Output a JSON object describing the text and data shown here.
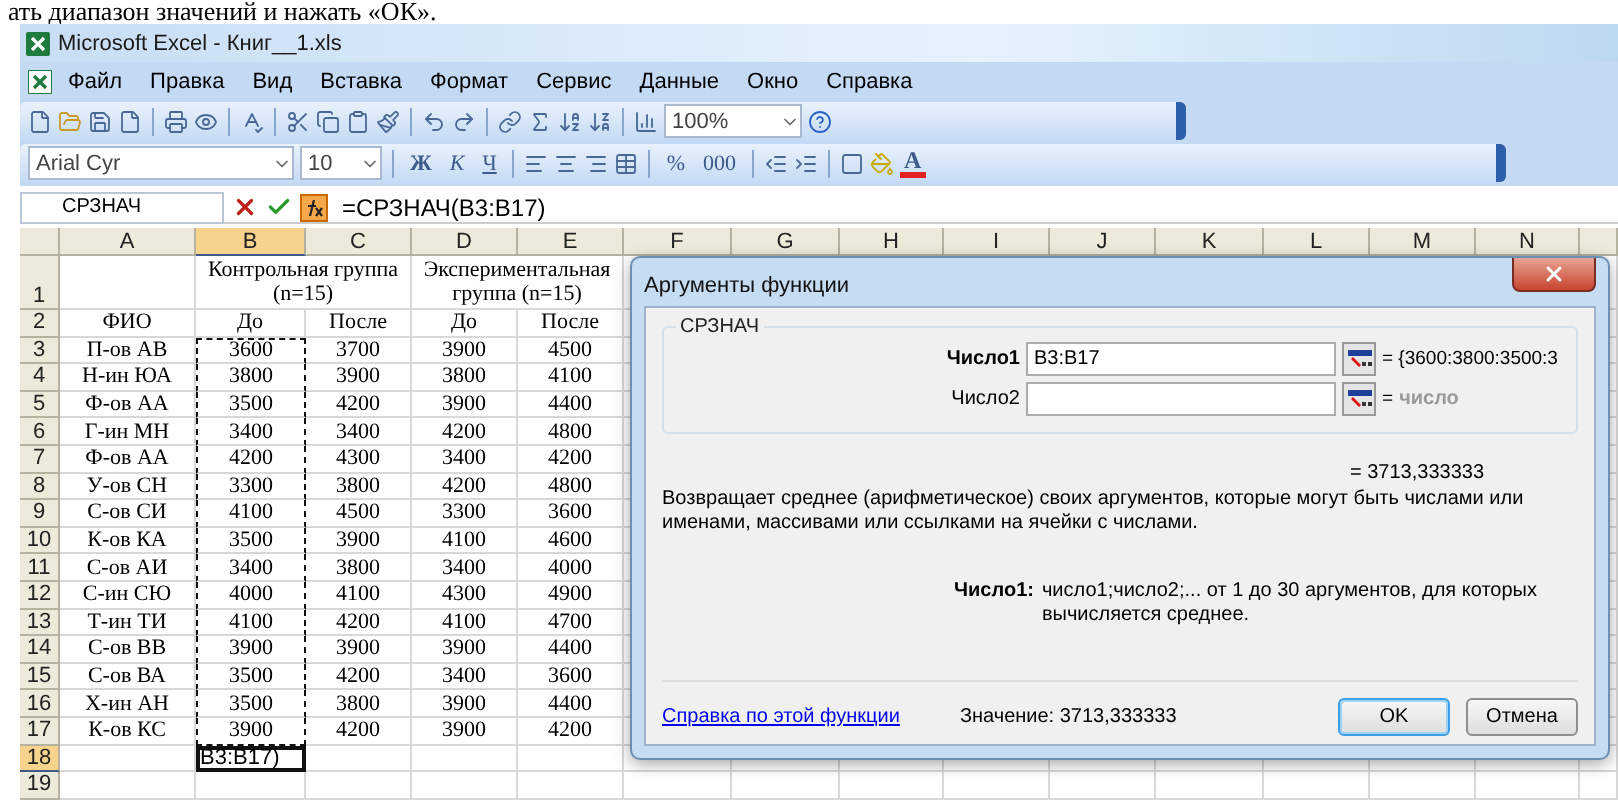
{
  "doc_text": "ать диапазон значений и нажать «ОК».",
  "window": {
    "title": "Microsoft Excel - Книг__1.xls"
  },
  "menu": [
    {
      "label": "Файл"
    },
    {
      "label": "Правка"
    },
    {
      "label": "Вид"
    },
    {
      "label": "Вставка"
    },
    {
      "label": "Формат"
    },
    {
      "label": "Сервис"
    },
    {
      "label": "Данные"
    },
    {
      "label": "Окно"
    },
    {
      "label": "Справка"
    }
  ],
  "toolbar": {
    "zoom": "100%"
  },
  "format_toolbar": {
    "font": "Arial Cyr",
    "size": "10",
    "style_buttons": [
      "Ж",
      "К",
      "Ч"
    ],
    "number_buttons": [
      "%",
      "000"
    ],
    "font_color_glyph": "A"
  },
  "formula_bar": {
    "name_box": "СРЗНАЧ",
    "formula": "=СРЗНАЧ(B3:B17)"
  },
  "sheet": {
    "columns": [
      {
        "label": "A",
        "selected": false
      },
      {
        "label": "B",
        "selected": true
      },
      {
        "label": "C",
        "selected": false
      },
      {
        "label": "D",
        "selected": false
      },
      {
        "label": "E",
        "selected": false
      },
      {
        "label": "F",
        "selected": false
      },
      {
        "label": "G",
        "selected": false
      },
      {
        "label": "H",
        "selected": false
      },
      {
        "label": "I",
        "selected": false
      },
      {
        "label": "J",
        "selected": false
      },
      {
        "label": "K",
        "selected": false
      },
      {
        "label": "L",
        "selected": false
      },
      {
        "label": "M",
        "selected": false
      },
      {
        "label": "N",
        "selected": false
      }
    ],
    "rows": [
      {
        "label": "1",
        "selected": false,
        "in_range": false,
        "groups": [
          "Контрольная группа (n=15)",
          "Экспериментальная группа (n=15)"
        ]
      },
      {
        "label": "2",
        "selected": false,
        "in_range": false,
        "cells": [
          "ФИО",
          "До",
          "После",
          "До",
          "После"
        ]
      },
      {
        "label": "3",
        "selected": false,
        "in_range": true,
        "cells": [
          "П-ов АВ",
          "3600",
          "3700",
          "3900",
          "4500"
        ]
      },
      {
        "label": "4",
        "selected": false,
        "in_range": true,
        "cells": [
          "Н-ин ЮА",
          "3800",
          "3900",
          "3800",
          "4100"
        ]
      },
      {
        "label": "5",
        "selected": false,
        "in_range": true,
        "cells": [
          "Ф-ов АА",
          "3500",
          "4200",
          "3900",
          "4400"
        ]
      },
      {
        "label": "6",
        "selected": false,
        "in_range": true,
        "cells": [
          "Г-ин МН",
          "3400",
          "3400",
          "4200",
          "4800"
        ]
      },
      {
        "label": "7",
        "selected": false,
        "in_range": true,
        "cells": [
          "Ф-ов АА",
          "4200",
          "4300",
          "3400",
          "4200"
        ]
      },
      {
        "label": "8",
        "selected": false,
        "in_range": true,
        "cells": [
          "У-ов СН",
          "3300",
          "3800",
          "4200",
          "4800"
        ]
      },
      {
        "label": "9",
        "selected": false,
        "in_range": true,
        "cells": [
          "С-ов СИ",
          "4100",
          "4500",
          "3300",
          "3600"
        ]
      },
      {
        "label": "10",
        "selected": false,
        "in_range": true,
        "cells": [
          "К-ов КА",
          "3500",
          "3900",
          "4100",
          "4600"
        ]
      },
      {
        "label": "11",
        "selected": false,
        "in_range": true,
        "cells": [
          "С-ов АИ",
          "3400",
          "3800",
          "3400",
          "4000"
        ]
      },
      {
        "label": "12",
        "selected": false,
        "in_range": true,
        "cells": [
          "С-ин СЮ",
          "4000",
          "4100",
          "4300",
          "4900"
        ]
      },
      {
        "label": "13",
        "selected": false,
        "in_range": true,
        "cells": [
          "Т-ин ТИ",
          "4100",
          "4200",
          "4100",
          "4700"
        ]
      },
      {
        "label": "14",
        "selected": false,
        "in_range": true,
        "cells": [
          "С-ов ВВ",
          "3900",
          "3900",
          "3900",
          "4400"
        ]
      },
      {
        "label": "15",
        "selected": false,
        "in_range": true,
        "cells": [
          "С-ов ВА",
          "3500",
          "4200",
          "3400",
          "3600"
        ]
      },
      {
        "label": "16",
        "selected": false,
        "in_range": true,
        "cells": [
          "Х-ин АН",
          "3500",
          "3800",
          "3900",
          "4400"
        ]
      },
      {
        "label": "17",
        "selected": false,
        "in_range": true,
        "cells": [
          "К-ов КС",
          "3900",
          "4200",
          "3900",
          "4200"
        ]
      },
      {
        "label": "18",
        "selected": true,
        "in_range": false,
        "edit_text": "B3:B17)"
      },
      {
        "label": "19",
        "selected": false,
        "in_range": false
      }
    ]
  },
  "dialog": {
    "title": "Аргументы функции",
    "function": "СРЗНАЧ",
    "args": [
      {
        "label": "Число1",
        "selected": true,
        "value": "B3:B17",
        "result": "= {3600:3800:3500:3"
      },
      {
        "label": "Число2",
        "selected": false,
        "result": "=",
        "hint": "число"
      }
    ],
    "total": "= 3713,333333",
    "description": "Возвращает среднее (арифметическое) своих аргументов, которые могут быть числами или именами, массивами или ссылками на ячейки с числами.",
    "arg_help": {
      "label": "Число1:",
      "text": "число1;число2;... от 1 до 30 аргументов, для которых вычисляется среднее."
    },
    "help_link": "Справка по этой функции",
    "value": "Значение: 3713,333333",
    "buttons": [
      {
        "label": "OK",
        "default": true
      },
      {
        "label": "Отмена",
        "default": false
      }
    ]
  }
}
